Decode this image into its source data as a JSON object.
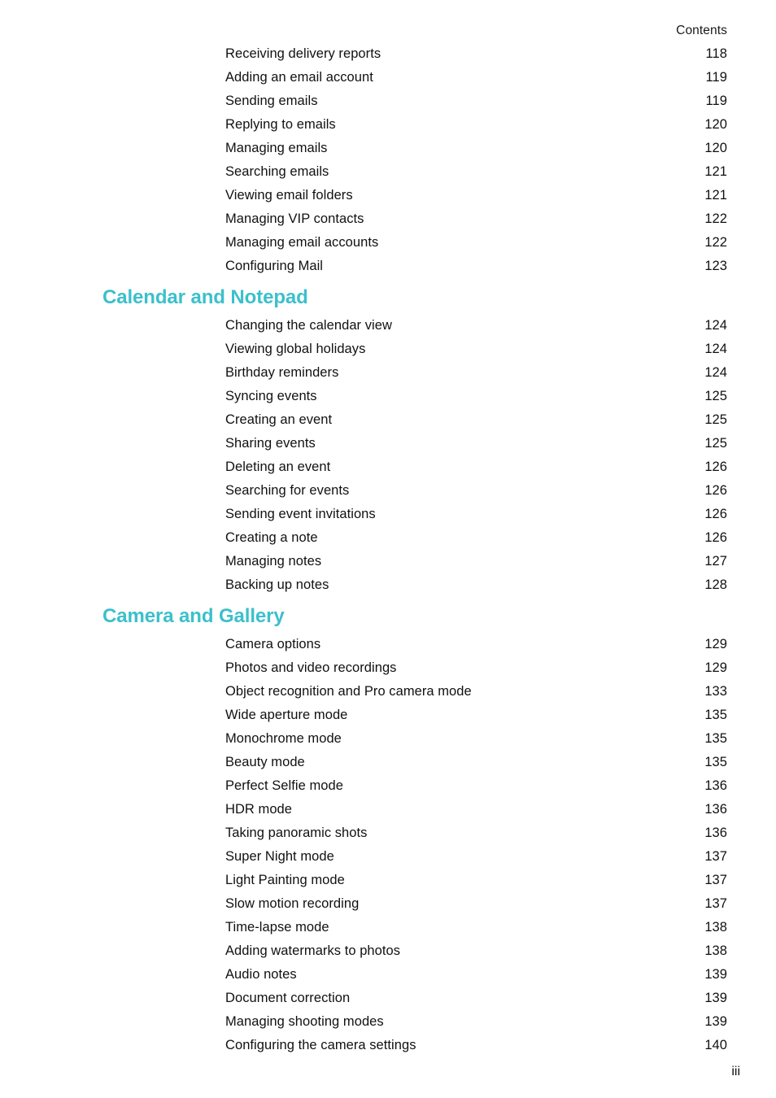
{
  "document": {
    "running_header": "Contents",
    "folio": "iii",
    "heading_color": "#3bc0cc",
    "text_color": "#111111"
  },
  "blocks": [
    {
      "type": "entries",
      "entries": [
        {
          "title": "Receiving delivery reports",
          "page": "118"
        },
        {
          "title": "Adding an email account",
          "page": "119"
        },
        {
          "title": "Sending emails",
          "page": "119"
        },
        {
          "title": "Replying to emails",
          "page": "120"
        },
        {
          "title": "Managing emails",
          "page": "120"
        },
        {
          "title": "Searching emails",
          "page": "121"
        },
        {
          "title": "Viewing email folders",
          "page": "121"
        },
        {
          "title": "Managing VIP contacts",
          "page": "122"
        },
        {
          "title": "Managing email accounts",
          "page": "122"
        },
        {
          "title": "Configuring Mail",
          "page": "123"
        }
      ]
    },
    {
      "type": "section",
      "heading": "Calendar and Notepad",
      "entries": [
        {
          "title": "Changing the calendar view",
          "page": "124"
        },
        {
          "title": "Viewing global holidays",
          "page": "124"
        },
        {
          "title": "Birthday reminders",
          "page": "124"
        },
        {
          "title": "Syncing events",
          "page": "125"
        },
        {
          "title": "Creating an event",
          "page": "125"
        },
        {
          "title": "Sharing events",
          "page": "125"
        },
        {
          "title": "Deleting an event",
          "page": "126"
        },
        {
          "title": "Searching for events",
          "page": "126"
        },
        {
          "title": "Sending event invitations",
          "page": "126"
        },
        {
          "title": "Creating a note",
          "page": "126"
        },
        {
          "title": "Managing notes",
          "page": "127"
        },
        {
          "title": "Backing up notes",
          "page": "128"
        }
      ]
    },
    {
      "type": "section",
      "heading": "Camera and Gallery",
      "entries": [
        {
          "title": "Camera options",
          "page": "129"
        },
        {
          "title": "Photos and video recordings",
          "page": "129"
        },
        {
          "title": "Object recognition and Pro camera mode",
          "page": "133"
        },
        {
          "title": "Wide aperture mode",
          "page": "135"
        },
        {
          "title": "Monochrome mode",
          "page": "135"
        },
        {
          "title": "Beauty mode",
          "page": "135"
        },
        {
          "title": "Perfect Selfie mode",
          "page": "136"
        },
        {
          "title": "HDR mode",
          "page": "136"
        },
        {
          "title": "Taking panoramic shots",
          "page": "136"
        },
        {
          "title": "Super Night mode",
          "page": "137"
        },
        {
          "title": "Light Painting mode",
          "page": "137"
        },
        {
          "title": "Slow motion recording",
          "page": "137"
        },
        {
          "title": "Time-lapse mode",
          "page": "138"
        },
        {
          "title": "Adding watermarks to photos",
          "page": "138"
        },
        {
          "title": "Audio notes",
          "page": "139"
        },
        {
          "title": "Document correction",
          "page": "139"
        },
        {
          "title": "Managing shooting modes",
          "page": "139"
        },
        {
          "title": "Configuring the camera settings",
          "page": "140"
        }
      ]
    }
  ]
}
